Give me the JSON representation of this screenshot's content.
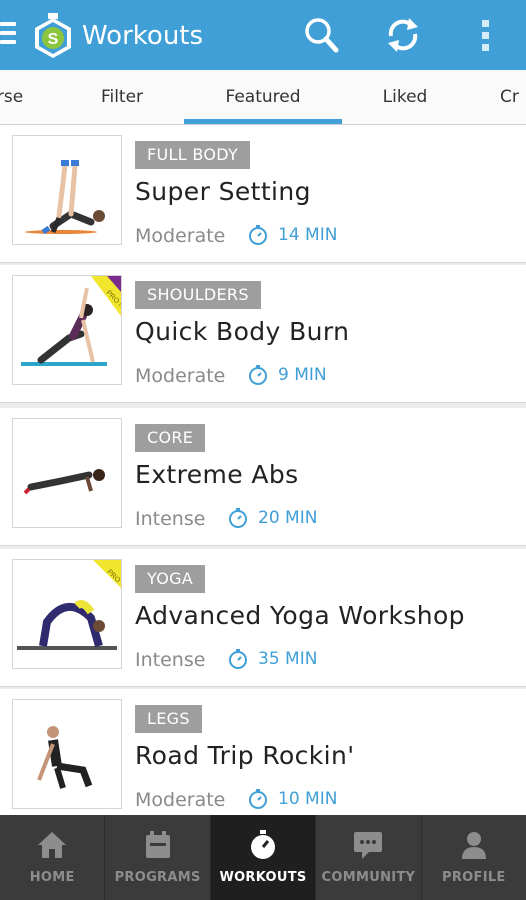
{
  "app": {
    "title": "Workouts"
  },
  "icons": {
    "menu": "hamburger-icon",
    "logo": "app-logo-icon",
    "search": "search-icon",
    "refresh": "refresh-icon",
    "overflow": "more-vert-icon",
    "duration": "stopwatch-icon"
  },
  "colors": {
    "primary": "#3f9fd6",
    "tag": "#9e9e9e",
    "nav_bg": "#3b3b3b",
    "nav_active": "#1f1f1f"
  },
  "tabs": [
    {
      "label": "rse",
      "active": false
    },
    {
      "label": "Filter",
      "active": false
    },
    {
      "label": "Featured",
      "active": true
    },
    {
      "label": "Liked",
      "active": false
    },
    {
      "label": "Cr",
      "active": false
    }
  ],
  "workouts": [
    {
      "category": "FULL BODY",
      "title": "Super Setting",
      "level": "Moderate",
      "duration": "14 MIN",
      "badge": ""
    },
    {
      "category": "SHOULDERS",
      "title": "Quick Body Burn",
      "level": "Moderate",
      "duration": "9 MIN",
      "badge": "PRO NEW"
    },
    {
      "category": "CORE",
      "title": "Extreme Abs",
      "level": "Intense",
      "duration": "20 MIN",
      "badge": ""
    },
    {
      "category": "YOGA",
      "title": "Advanced Yoga Workshop",
      "level": "Intense",
      "duration": "35 MIN",
      "badge": "PRO"
    },
    {
      "category": "LEGS",
      "title": "Road Trip Rockin'",
      "level": "Moderate",
      "duration": "10 MIN",
      "badge": ""
    }
  ],
  "bottom_nav": [
    {
      "label": "HOME",
      "icon": "home-icon",
      "active": false
    },
    {
      "label": "PROGRAMS",
      "icon": "calendar-icon",
      "active": false
    },
    {
      "label": "WORKOUTS",
      "icon": "stopwatch-icon",
      "active": true
    },
    {
      "label": "COMMUNITY",
      "icon": "chat-icon",
      "active": false
    },
    {
      "label": "PROFILE",
      "icon": "person-icon",
      "active": false
    }
  ]
}
